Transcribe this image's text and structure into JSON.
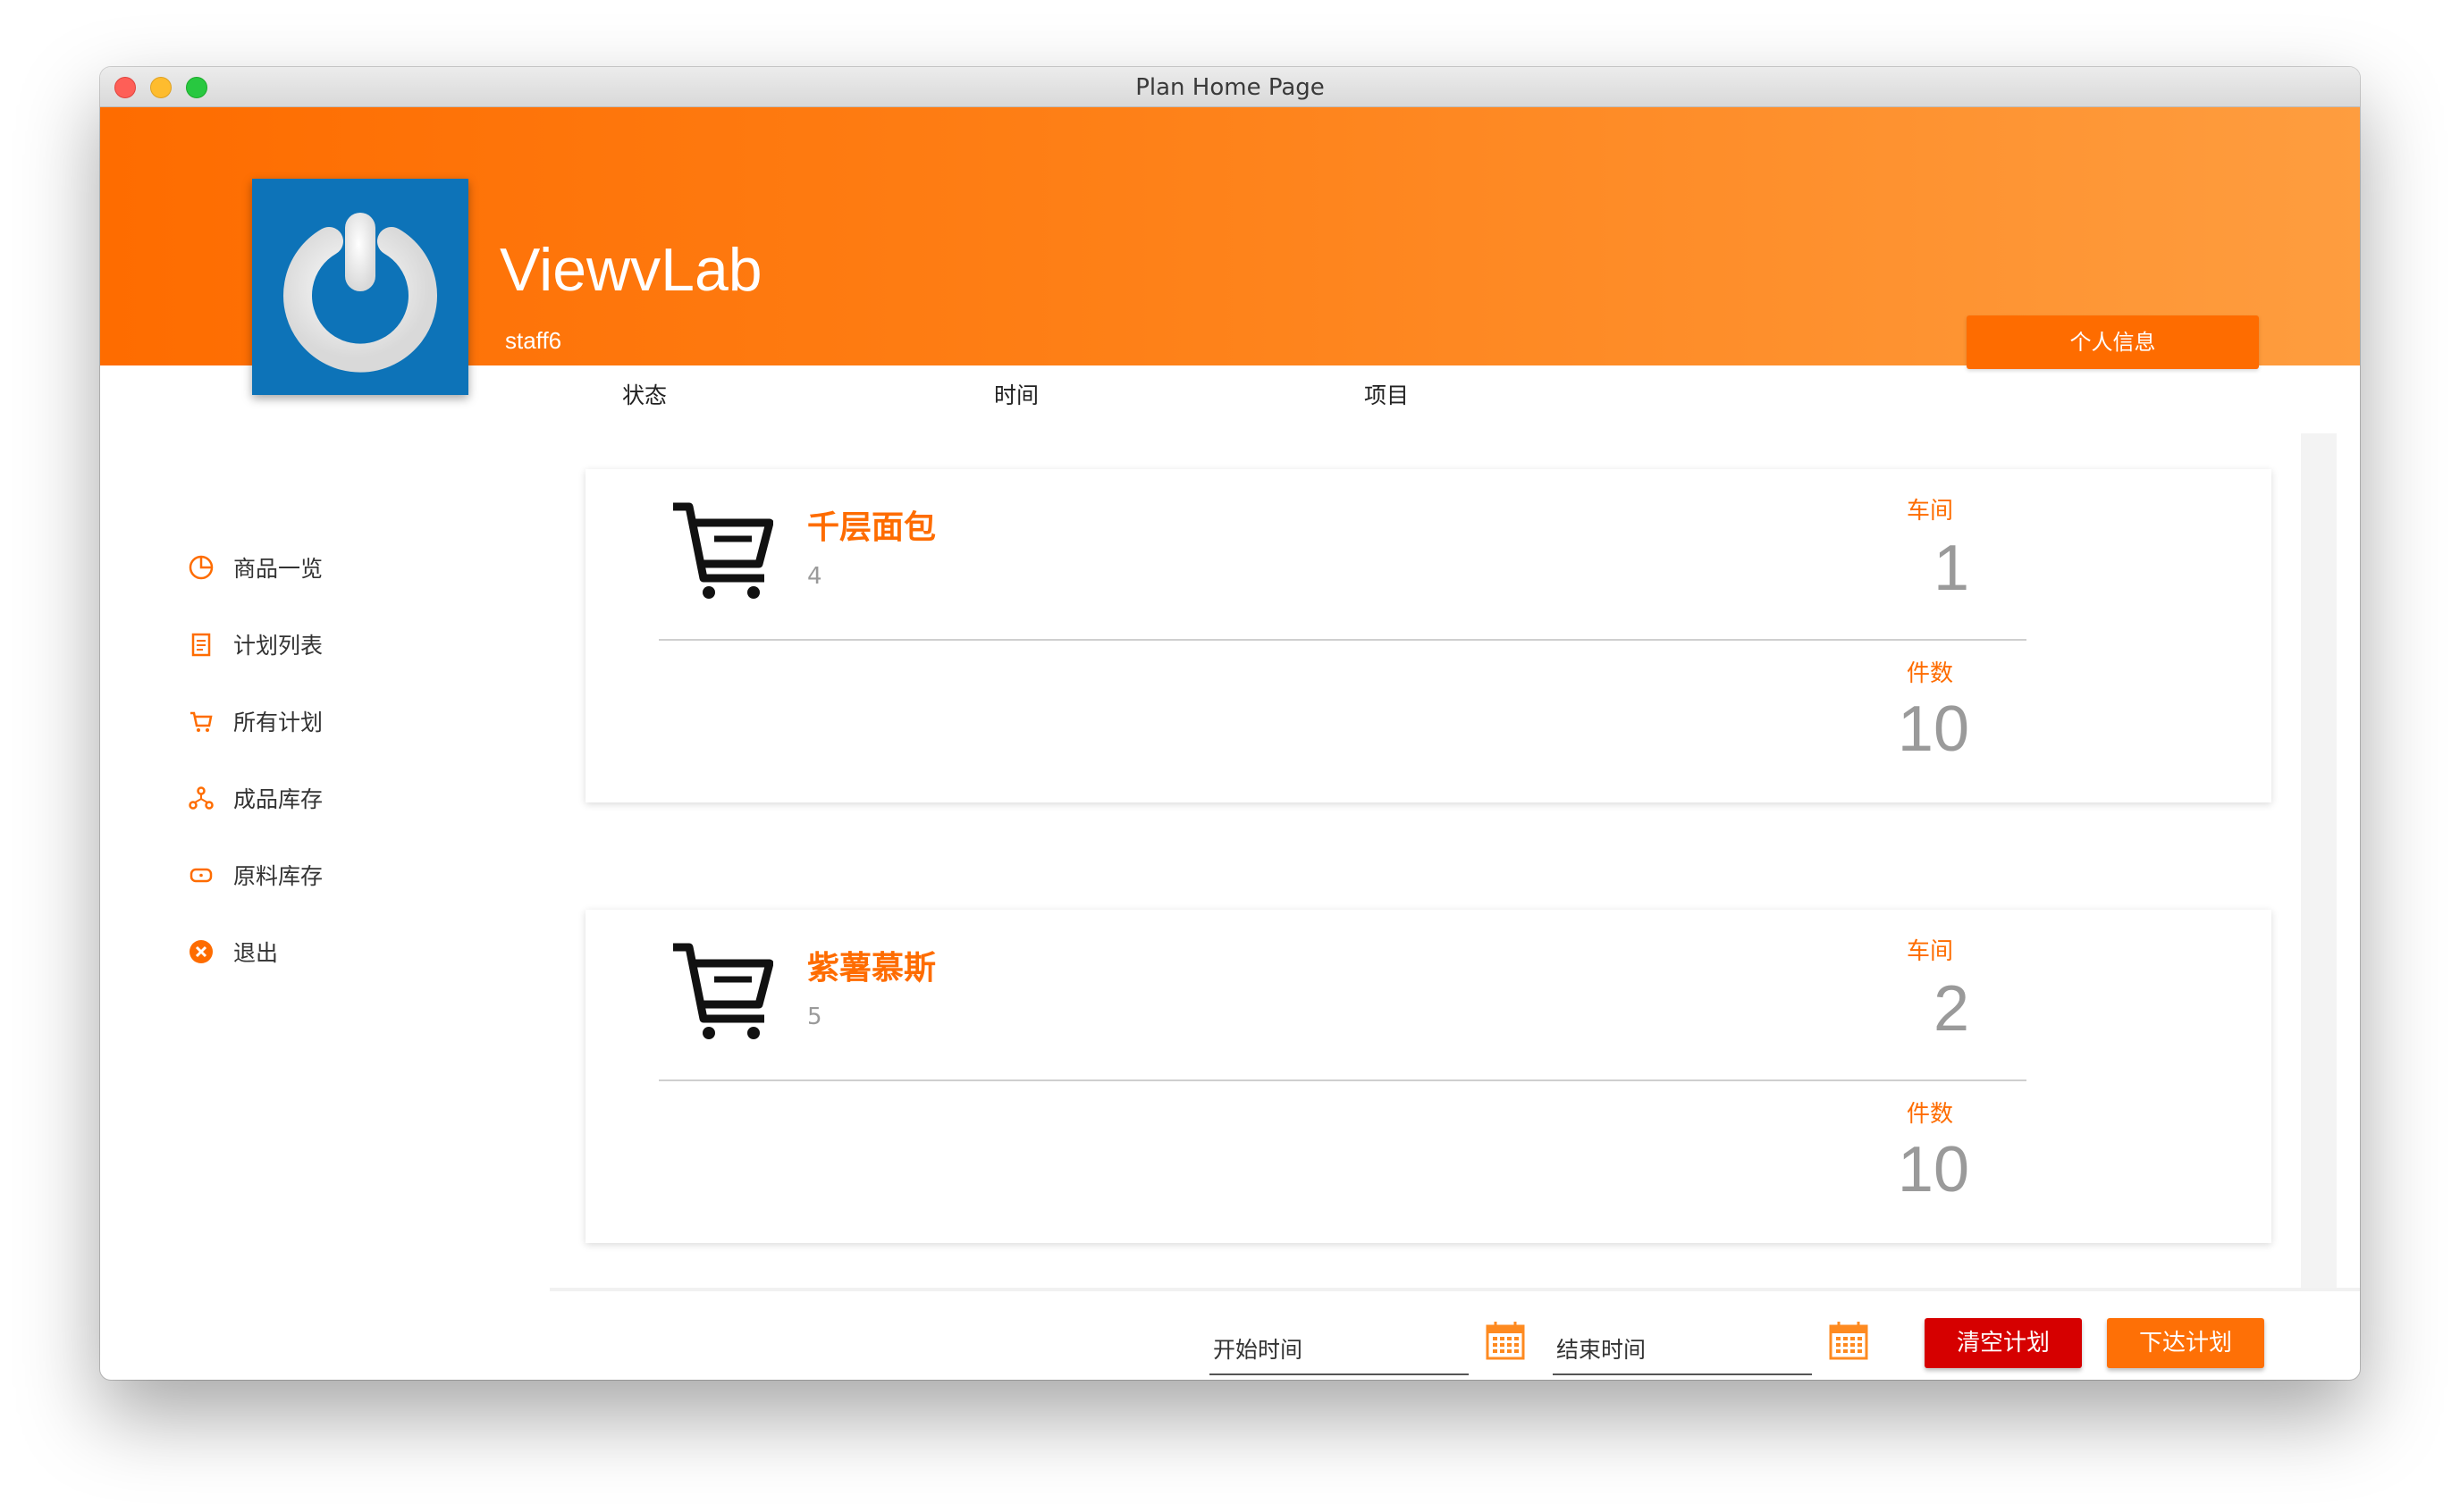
{
  "window": {
    "title": "Plan Home Page"
  },
  "header": {
    "app_name": "ViewvLab",
    "username": "staff6",
    "profile_button": "个人信息"
  },
  "columns": [
    "状态",
    "时间",
    "项目"
  ],
  "sidebar": {
    "items": [
      {
        "label": "商品一览",
        "icon": "pie-chart-icon"
      },
      {
        "label": "计划列表",
        "icon": "clipboard-icon"
      },
      {
        "label": "所有计划",
        "icon": "cart-icon"
      },
      {
        "label": "成品库存",
        "icon": "hierarchy-icon"
      },
      {
        "label": "原料库存",
        "icon": "tag-icon"
      },
      {
        "label": "退出",
        "icon": "close-circle-icon"
      }
    ]
  },
  "plans": [
    {
      "name": "千层面包",
      "id": "4",
      "workshop_label": "车间",
      "workshop": "1",
      "qty_label": "件数",
      "qty": "10"
    },
    {
      "name": "紫薯慕斯",
      "id": "5",
      "workshop_label": "车间",
      "workshop": "2",
      "qty_label": "件数",
      "qty": "10"
    }
  ],
  "footer": {
    "start_time_placeholder": "开始时间",
    "end_time_placeholder": "结束时间",
    "clear_button": "清空计划",
    "issue_button": "下达计划"
  },
  "colors": {
    "accent": "#fe6c00",
    "danger": "#d60000",
    "logo_bg": "#0d73b8"
  }
}
